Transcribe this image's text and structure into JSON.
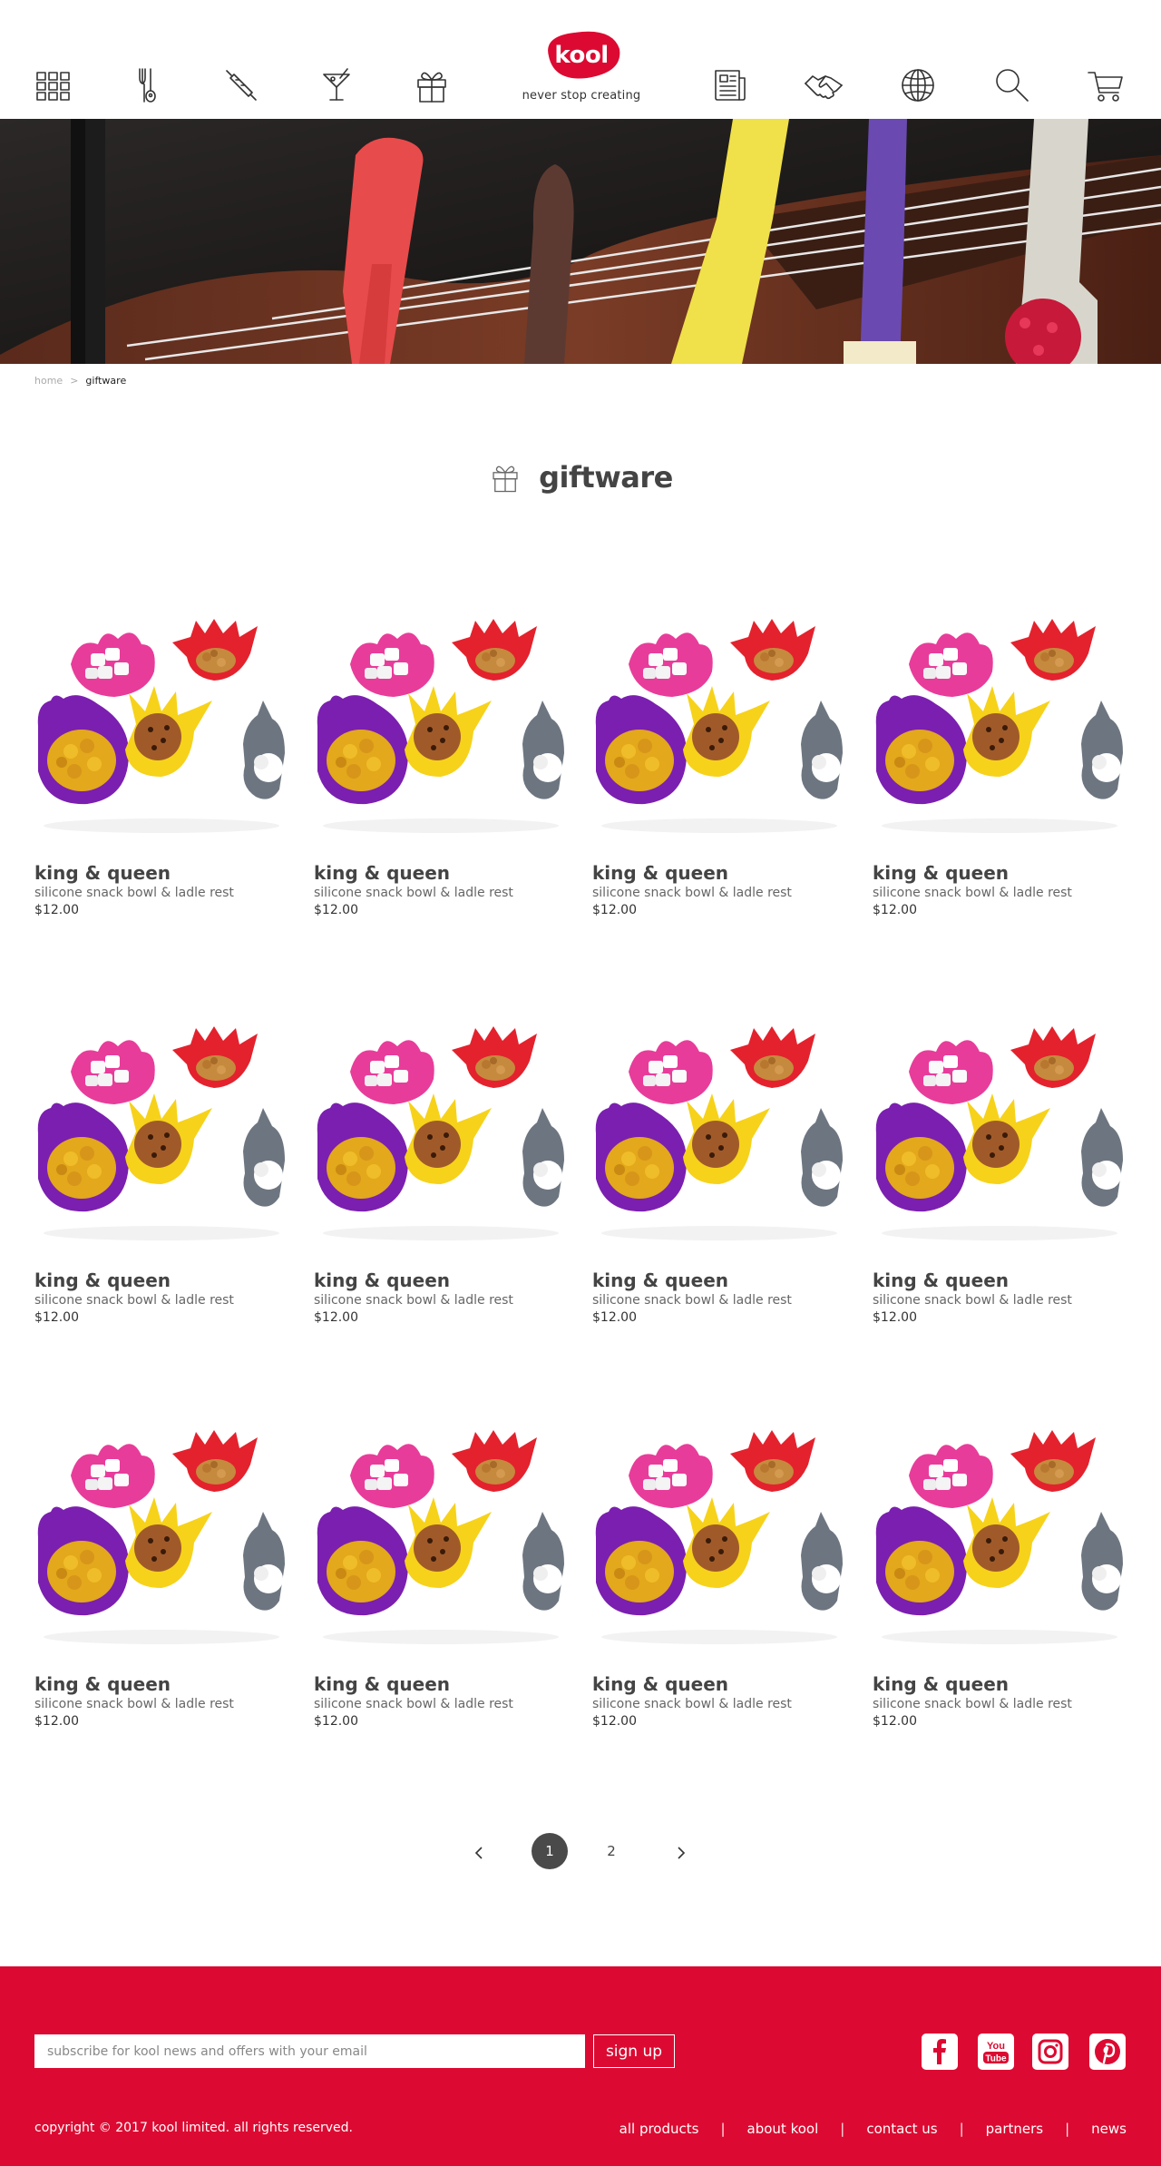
{
  "brand": {
    "name": "kool",
    "tagline": "never stop creating",
    "color": "#dc0a32"
  },
  "nav": {
    "icons": [
      "grid-icon",
      "kitchen-utensils-icon",
      "rolling-pin-icon",
      "cocktail-glass-icon",
      "gift-icon",
      "news-icon",
      "handshake-icon",
      "globe-icon",
      "search-icon",
      "cart-icon"
    ]
  },
  "breadcrumb": {
    "home": "home",
    "separator": ">",
    "current": "giftware"
  },
  "page": {
    "title": "giftware",
    "title_icon": "gift-icon"
  },
  "products": [
    {
      "name": "king & queen",
      "desc": "silicone snack bowl & ladle rest",
      "price": "$12.00"
    },
    {
      "name": "king & queen",
      "desc": "silicone snack bowl & ladle rest",
      "price": "$12.00"
    },
    {
      "name": "king & queen",
      "desc": "silicone snack bowl & ladle rest",
      "price": "$12.00"
    },
    {
      "name": "king & queen",
      "desc": "silicone snack bowl & ladle rest",
      "price": "$12.00"
    },
    {
      "name": "king & queen",
      "desc": "silicone snack bowl & ladle rest",
      "price": "$12.00"
    },
    {
      "name": "king & queen",
      "desc": "silicone snack bowl & ladle rest",
      "price": "$12.00"
    },
    {
      "name": "king & queen",
      "desc": "silicone snack bowl & ladle rest",
      "price": "$12.00"
    },
    {
      "name": "king & queen",
      "desc": "silicone snack bowl & ladle rest",
      "price": "$12.00"
    },
    {
      "name": "king & queen",
      "desc": "silicone snack bowl & ladle rest",
      "price": "$12.00"
    },
    {
      "name": "king & queen",
      "desc": "silicone snack bowl & ladle rest",
      "price": "$12.00"
    },
    {
      "name": "king & queen",
      "desc": "silicone snack bowl & ladle rest",
      "price": "$12.00"
    },
    {
      "name": "king & queen",
      "desc": "silicone snack bowl & ladle rest",
      "price": "$12.00"
    }
  ],
  "pagination": {
    "pages": [
      "1",
      "2"
    ],
    "current": "1"
  },
  "footer": {
    "subscribe_placeholder": "subscribe for kool news and offers with your email",
    "subscribe_button": "sign up",
    "social": [
      "facebook-icon",
      "youtube-icon",
      "instagram-icon",
      "pinterest-icon"
    ],
    "youtube_text_top": "You",
    "youtube_text_bottom": "Tube",
    "copyright": "copyright © 2017 kool limited. all rights reserved.",
    "links": [
      "all products",
      "about kool",
      "contact us",
      "partners",
      "news"
    ],
    "link_separator": "|"
  }
}
